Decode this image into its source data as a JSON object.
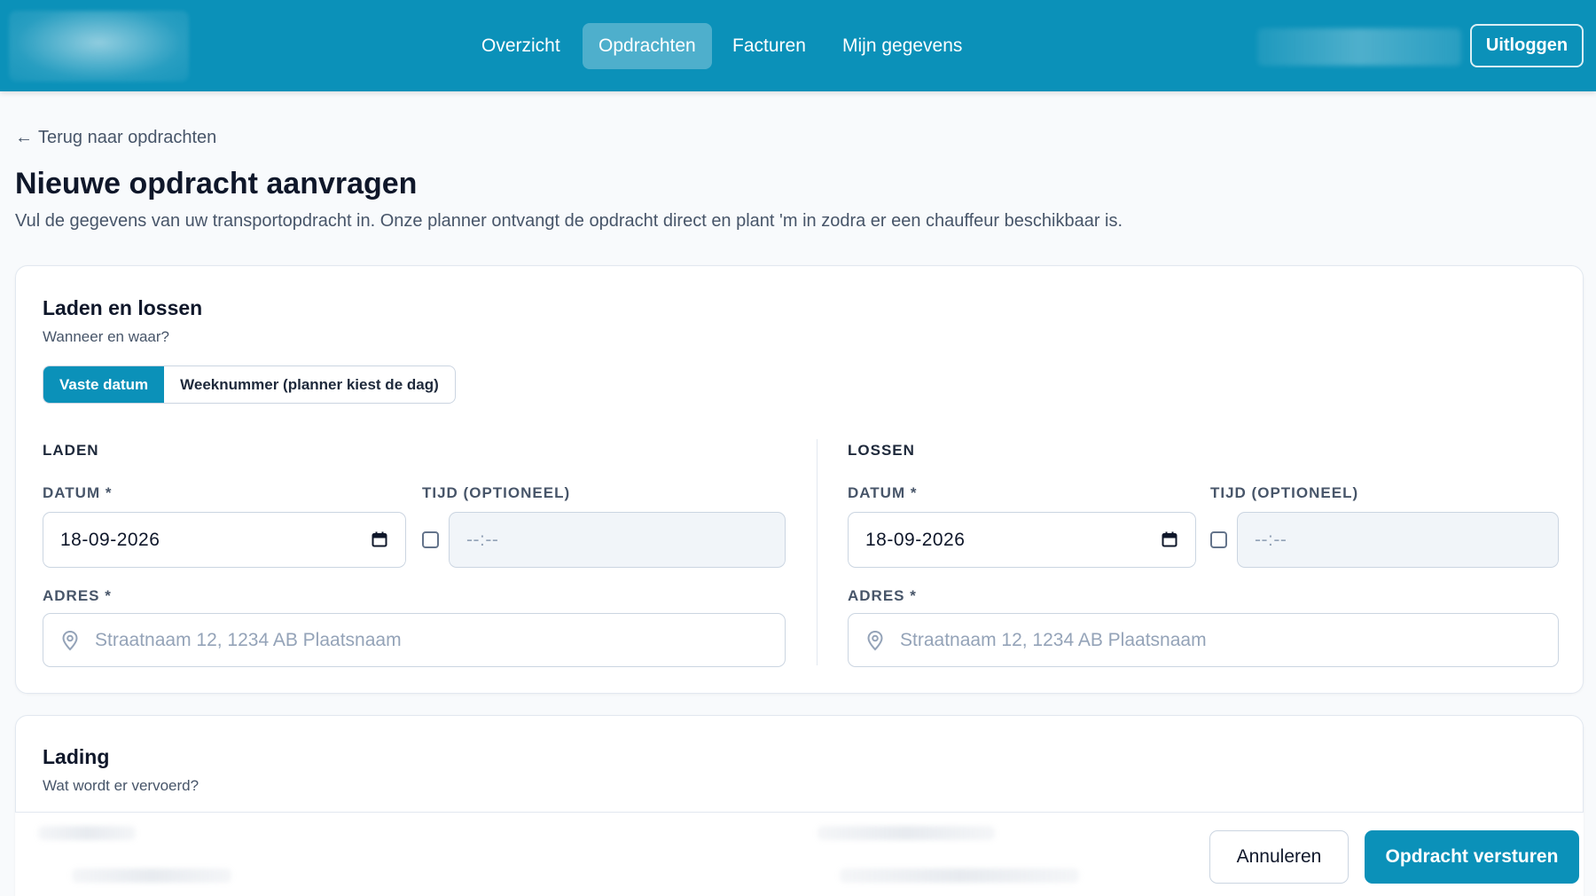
{
  "nav": {
    "items": [
      {
        "label": "Overzicht",
        "active": false
      },
      {
        "label": "Opdrachten",
        "active": true
      },
      {
        "label": "Facturen",
        "active": false
      },
      {
        "label": "Mijn gegevens",
        "active": false
      }
    ],
    "logout_label": "Uitloggen"
  },
  "page": {
    "back_link": "Terug naar opdrachten",
    "back_icon": "arrow-left-icon",
    "title": "Nieuwe opdracht aanvragen",
    "subtitle": "Vul de gegevens van uw transportopdracht in. Onze planner ontvangt de opdracht direct en plant 'm in zodra er een chauffeur beschikbaar is."
  },
  "card_loading": {
    "title": "Laden en lossen",
    "subtitle": "Wanneer en waar?",
    "toggle": {
      "options": [
        "Vaste datum",
        "Weeknummer (planner kiest de dag)"
      ],
      "selected": "Vaste datum"
    },
    "laden": {
      "heading": "LADEN",
      "date_label": "DATUM *",
      "date_value": "18-09-2026",
      "time_label": "TIJD (OPTIONEEL)",
      "time_placeholder": "--:--",
      "time_enabled": false,
      "address_label": "ADRES *",
      "address_placeholder": "Straatnaam 12, 1234 AB Plaatsnaam"
    },
    "lossen": {
      "heading": "LOSSEN",
      "date_label": "DATUM *",
      "date_value": "18-09-2026",
      "time_label": "TIJD (OPTIONEEL)",
      "time_placeholder": "--:--",
      "time_enabled": false,
      "address_label": "ADRES *",
      "address_placeholder": "Straatnaam 12, 1234 AB Plaatsnaam"
    }
  },
  "card_cargo": {
    "title": "Lading",
    "subtitle": "Wat wordt er vervoerd?"
  },
  "footer": {
    "cancel_label": "Annuleren",
    "submit_label": "Opdracht versturen"
  },
  "colors": {
    "brand": "#0b91b9",
    "text": "#0f172a",
    "muted": "#475569",
    "border": "#cbd5e1",
    "background": "#f8fafc"
  }
}
